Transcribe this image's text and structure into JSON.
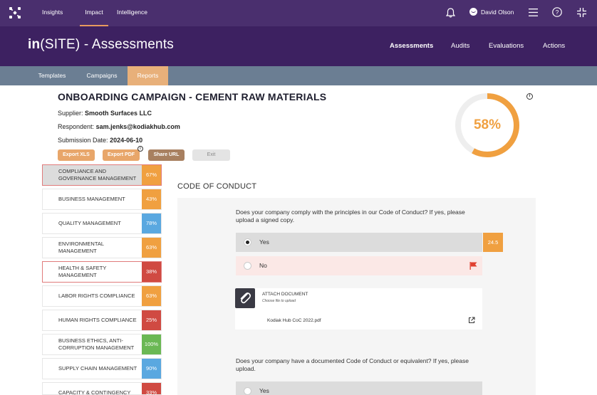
{
  "topbar": {
    "nav": [
      {
        "label": "Insights",
        "active": false
      },
      {
        "label": "Impact",
        "active": true
      },
      {
        "label": "Intelligence",
        "active": false
      }
    ],
    "user_name": "David Olson",
    "icons": [
      "bell-icon",
      "user-icon",
      "hamburger-icon",
      "help-icon",
      "collapse-icon"
    ]
  },
  "banner": {
    "brand_bold": "in",
    "brand_rest": "(SITE) - Assessments",
    "nav": [
      {
        "label": "Assessments",
        "active": true
      },
      {
        "label": "Audits",
        "active": false
      },
      {
        "label": "Evaluations",
        "active": false
      },
      {
        "label": "Actions",
        "active": false
      }
    ]
  },
  "subnav": {
    "tabs": [
      {
        "label": "Templates",
        "active": false
      },
      {
        "label": "Campaigns",
        "active": false
      },
      {
        "label": "Reports",
        "active": true
      }
    ]
  },
  "report": {
    "title": "ONBOARDING CAMPAIGN - CEMENT RAW MATERIALS",
    "supplier_label": "Supplier:",
    "supplier_value": "Smooth Surfaces LLC",
    "respondent_label": "Respondent:",
    "respondent_value": "sam.jenks@kodiakhub.com",
    "submission_label": "Submission Date:",
    "submission_value": "2024-06-10",
    "buttons": {
      "export_xls": "Export XLS",
      "export_pdf": "Export PDF",
      "share_url": "Share URL",
      "exit": "Exit"
    },
    "score_label": "58%",
    "score_value": 58
  },
  "colors": {
    "topbar": "#4a2f6e",
    "banner": "#3d2161",
    "subnav": "#6b7e93",
    "accent_orange": "#f0a040",
    "red": "#d04a42",
    "blue": "#5aa8e0",
    "green": "#6ab854"
  },
  "sidebar": {
    "items": [
      {
        "label": "COMPLIANCE AND GOVERNANCE MANAGEMENT",
        "score": "67%",
        "color": "#f0a040",
        "state": "selected"
      },
      {
        "label": "BUSINESS MANAGEMENT",
        "score": "43%",
        "color": "#f0a040",
        "state": ""
      },
      {
        "label": "QUALITY MANAGEMENT",
        "score": "78%",
        "color": "#5aa8e0",
        "state": ""
      },
      {
        "label": "ENVIRONMENTAL MANAGEMENT",
        "score": "63%",
        "color": "#f0a040",
        "state": ""
      },
      {
        "label": "HEALTH & SAFETY MANAGEMENT",
        "score": "38%",
        "color": "#d04a42",
        "state": "outlined"
      },
      {
        "label": "LABOR RIGHTS COMPLIANCE",
        "score": "63%",
        "color": "#f0a040",
        "state": ""
      },
      {
        "label": "HUMAN RIGHTS COMPLIANCE",
        "score": "25%",
        "color": "#d04a42",
        "state": ""
      },
      {
        "label": "BUSINESS ETHICS, ANTI-CORRUPTION MANAGEMENT",
        "score": "100%",
        "color": "#6ab854",
        "state": ""
      },
      {
        "label": "SUPPLY CHAIN MANAGEMENT",
        "score": "90%",
        "color": "#5aa8e0",
        "state": ""
      },
      {
        "label": "CAPACITY & CONTINGENCY",
        "score": "33%",
        "color": "#d04a42",
        "state": ""
      }
    ]
  },
  "section": {
    "title": "CODE OF CONDUCT",
    "q1": "Does your company comply with the principles in our Code of Conduct? If yes, please upload a signed copy.",
    "q1_yes": "Yes",
    "q1_no": "No",
    "q1_score": "24.5",
    "attach_title": "ATTACH DOCUMENT",
    "attach_sub": "Choose file to upload",
    "attach_file": "Kodiak Hub CoC 2022.pdf",
    "q2": "Does your company have a documented Code of Conduct or equivalent? If yes, please upload.",
    "q2_yes": "Yes"
  }
}
